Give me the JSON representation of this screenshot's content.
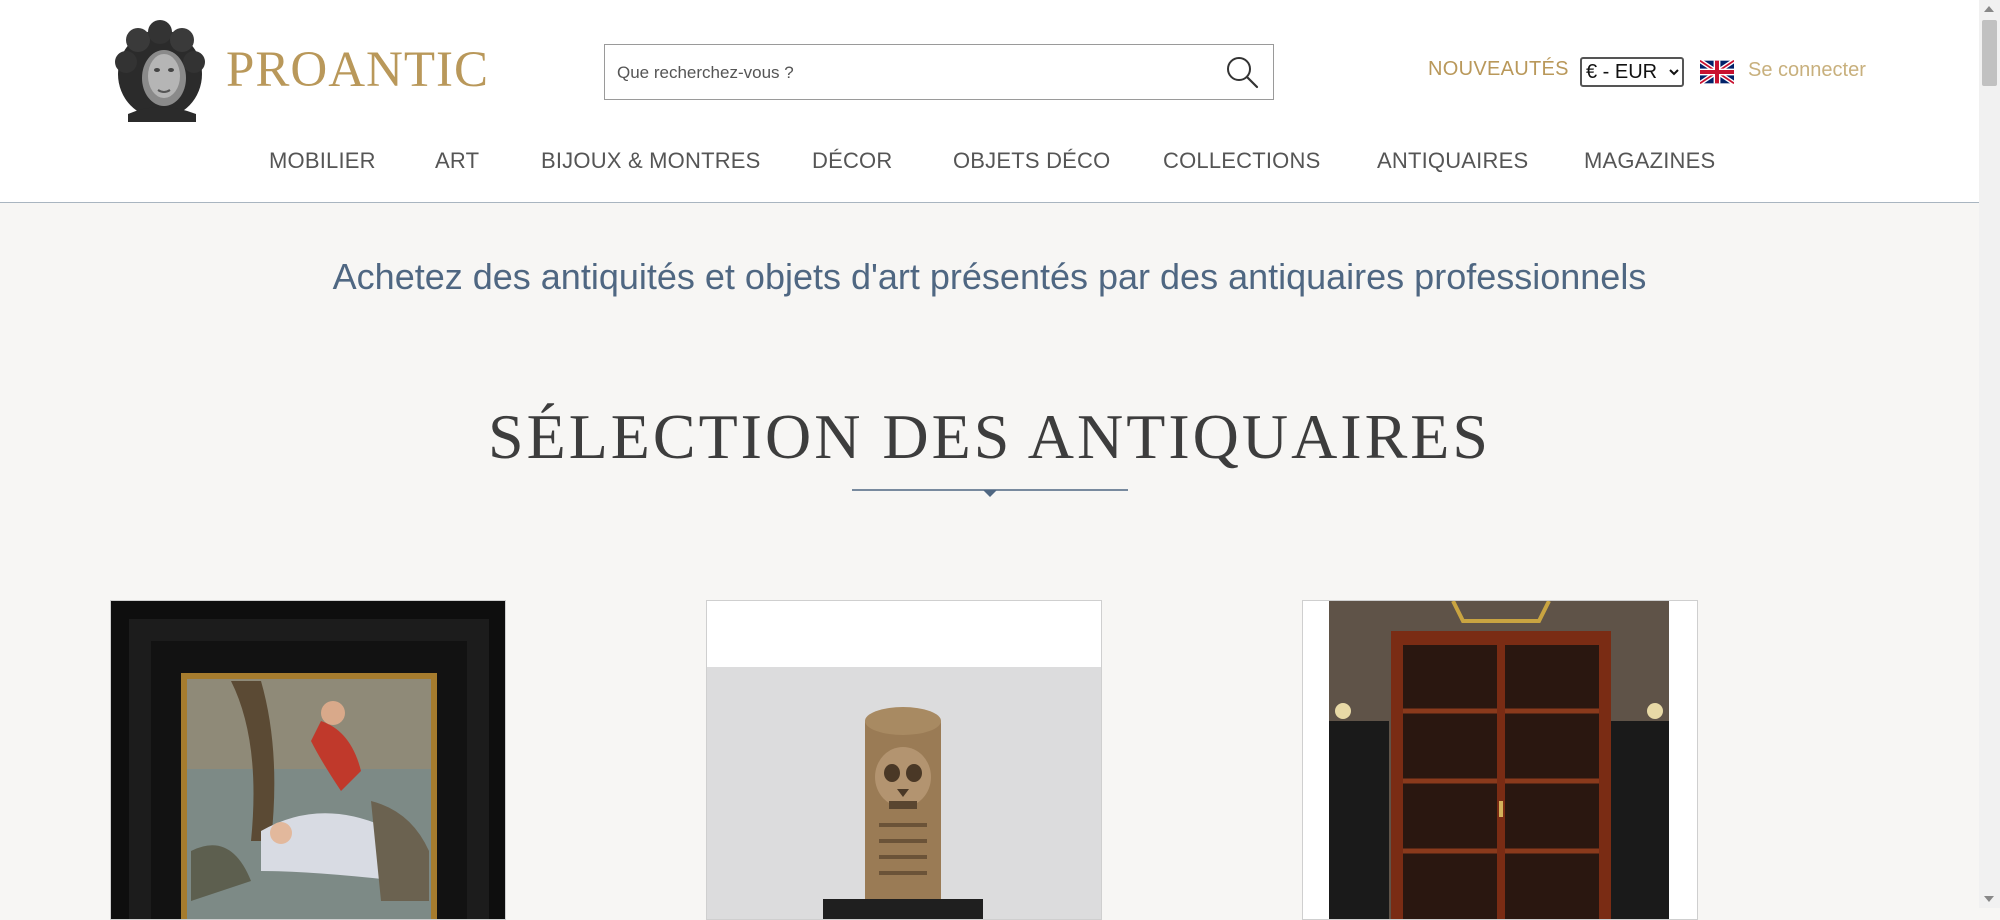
{
  "header": {
    "logo_text": "PROANTIC",
    "search_placeholder": "Que recherchez-vous ?",
    "nouveautes": "NOUVEAUTÉS",
    "currency": "€ - EUR",
    "login": "Se connecter"
  },
  "nav": [
    "MOBILIER",
    "ART",
    "BIJOUX & MONTRES",
    "DÉCOR",
    "OBJETS DÉCO",
    "COLLECTIONS",
    "ANTIQUAIRES",
    "MAGAZINES"
  ],
  "main": {
    "tagline": "Achetez des antiquités et objets d'art présentés par des antiquaires professionnels",
    "section_title": "SÉLECTION DES ANTIQUAIRES"
  },
  "colors": {
    "brand_gold": "#b9985a",
    "tagline_blue": "#4f6782",
    "background": "#f7f6f4"
  },
  "icons": {
    "search": "search-icon",
    "flag": "uk-flag-icon"
  }
}
